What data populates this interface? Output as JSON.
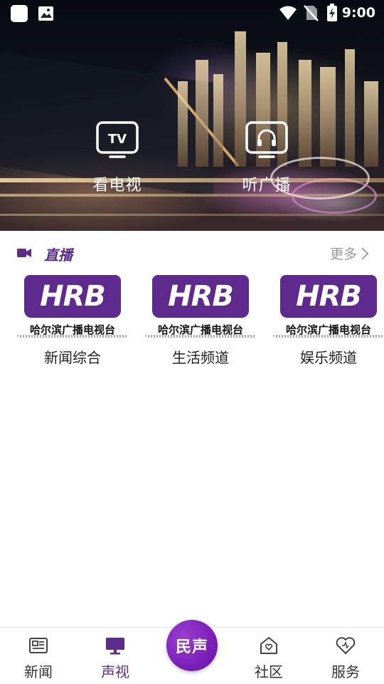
{
  "status_bar": {
    "time": "9:00",
    "icons": [
      "app-square-icon",
      "image-icon",
      "wifi-icon",
      "no-sim-icon",
      "battery-charging-icon"
    ]
  },
  "hero": {
    "tv_label": "看电视",
    "radio_label": "听广播",
    "tv_icon_text": "TV"
  },
  "live": {
    "title": "直播",
    "more": "更多",
    "channels": [
      {
        "logo_text": "HRB",
        "logo_subtitle": "哈尔滨广播电视台",
        "name": "新闻综合"
      },
      {
        "logo_text": "HRB",
        "logo_subtitle": "哈尔滨广播电视台",
        "name": "生活频道"
      },
      {
        "logo_text": "HRB",
        "logo_subtitle": "哈尔滨广播电视台",
        "name": "娱乐频道"
      }
    ]
  },
  "bottom_nav": {
    "items": [
      {
        "label": "新闻",
        "icon": "newspaper-icon",
        "active": false
      },
      {
        "label": "声视",
        "icon": "monitor-icon",
        "active": true
      },
      {
        "label": "社区",
        "icon": "home-heart-icon",
        "active": false
      },
      {
        "label": "服务",
        "icon": "heart-icon",
        "active": false
      }
    ],
    "center_label": "民声"
  },
  "colors": {
    "accent": "#5e2a8e",
    "center_button": "#7b1fb8",
    "more_text": "#9a9a9a"
  }
}
